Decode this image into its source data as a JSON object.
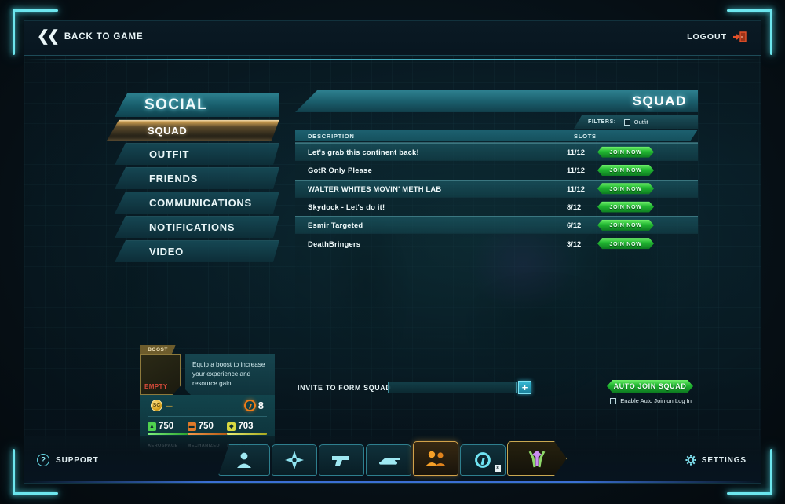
{
  "topbar": {
    "back_label": "BACK TO GAME",
    "back_icon": "double-chevron-left-icon",
    "logout_label": "LOGOUT",
    "logout_icon": "exit-door-icon"
  },
  "sidemenu": {
    "title": "SOCIAL",
    "items": [
      {
        "label": "SQUAD",
        "active": true
      },
      {
        "label": "OUTFIT",
        "active": false
      },
      {
        "label": "FRIENDS",
        "active": false
      },
      {
        "label": "COMMUNICATIONS",
        "active": false
      },
      {
        "label": "NOTIFICATIONS",
        "active": false
      },
      {
        "label": "VIDEO",
        "active": false
      }
    ]
  },
  "boost": {
    "tab_label": "BOOST",
    "slot_state": "EMPTY",
    "description": "Equip a boost to increase your experience and resource gain."
  },
  "resources": {
    "currency_icon": "station-cash-icon",
    "currency_value": "----",
    "cert_icon": "certification-icon",
    "cert_value": "8",
    "items": [
      {
        "icon": "aerospace-icon",
        "value": "750",
        "label": "AEROSPACE",
        "color": "#4fd14f"
      },
      {
        "icon": "mechanized-icon",
        "value": "750",
        "label": "MECHANIZED",
        "color": "#e07a2a"
      },
      {
        "icon": "infantry-icon",
        "value": "703",
        "label": "INFANTRY",
        "color": "#d8d842"
      }
    ]
  },
  "panel": {
    "title": "SQUAD",
    "filters_label": "FILTERS:",
    "filter_outfit_label": "Outfit",
    "filter_outfit_checked": false,
    "columns": {
      "description": "DESCRIPTION",
      "slots": "SLOTS"
    },
    "join_label": "JOIN NOW",
    "rows": [
      {
        "name": "Let's grab this continent back!",
        "slots": "11/12"
      },
      {
        "name": "GotR Only Please",
        "slots": "11/12"
      },
      {
        "name": "WALTER WHITES MOVIN' METH LAB",
        "slots": "11/12"
      },
      {
        "name": "Skydock - Let's do it!",
        "slots": "8/12"
      },
      {
        "name": "Esmir Targeted",
        "slots": "6/12"
      },
      {
        "name": "DeathBringers",
        "slots": "3/12"
      }
    ],
    "invite_label": "INVITE TO FORM SQUAD",
    "invite_value": "",
    "invite_placeholder": "",
    "add_icon": "plus-icon",
    "auto_join_label": "AUTO JOIN SQUAD",
    "auto_join_option": "Enable Auto Join on Log In",
    "auto_join_checked": false
  },
  "bottombar": {
    "support_label": "SUPPORT",
    "support_icon": "question-mark-icon",
    "settings_label": "SETTINGS",
    "settings_icon": "gear-icon",
    "nav": [
      {
        "icon": "character-icon",
        "active": false
      },
      {
        "icon": "map-star-icon",
        "active": false
      },
      {
        "icon": "weapon-pistol-icon",
        "active": false
      },
      {
        "icon": "vehicle-tank-icon",
        "active": false
      },
      {
        "icon": "social-people-icon",
        "active": true
      },
      {
        "icon": "certification-icon",
        "active": false,
        "badge": "8"
      },
      {
        "icon": "faction-emblem-icon",
        "active": false
      }
    ]
  },
  "colors": {
    "accent_cyan": "#4fd8e4",
    "accent_green": "#22b832",
    "accent_gold": "#c79a4e",
    "accent_orange": "#f07d18"
  }
}
